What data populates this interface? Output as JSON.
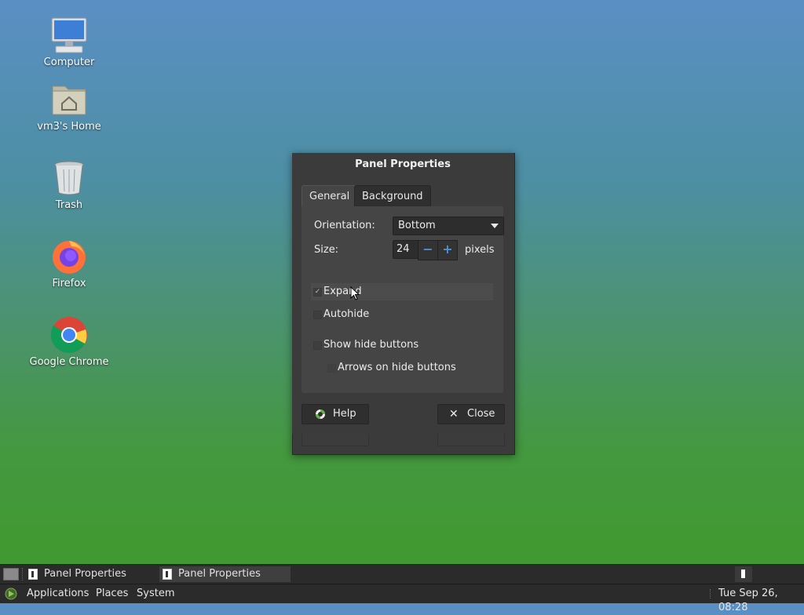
{
  "desktop": {
    "icons": [
      {
        "label": "Computer",
        "icon": "computer-icon"
      },
      {
        "label": "vm3's Home",
        "icon": "home-folder-icon"
      },
      {
        "label": "Trash",
        "icon": "trash-icon"
      },
      {
        "label": "Firefox",
        "icon": "firefox-icon"
      },
      {
        "label": "Google Chrome",
        "icon": "chrome-icon"
      }
    ]
  },
  "dialog": {
    "title": "Panel Properties",
    "tabs": [
      {
        "label": "General",
        "active": true
      },
      {
        "label": "Background",
        "active": false
      }
    ],
    "orientation_label": "Orientation:",
    "orientation_value": "Bottom",
    "size_label": "Size:",
    "size_value": "24",
    "size_unit": "pixels",
    "expand_label": "Expand",
    "expand_checked": true,
    "autohide_label": "Autohide",
    "show_hide_buttons_label": "Show hide buttons",
    "arrows_label": "Arrows on hide buttons",
    "help_label": "Help",
    "close_label": "Close"
  },
  "taskbar": {
    "windows": [
      {
        "label": "Panel Properties",
        "active": false
      },
      {
        "label": "Panel Properties",
        "active": true
      }
    ]
  },
  "menubar": {
    "applications": "Applications",
    "places": "Places",
    "system": "System",
    "clock": "Tue Sep 26, 08:28"
  },
  "colors": {
    "accent": "#4a90d9",
    "dialog_bg": "#3b3b3b",
    "panel_bg": "#454545"
  }
}
